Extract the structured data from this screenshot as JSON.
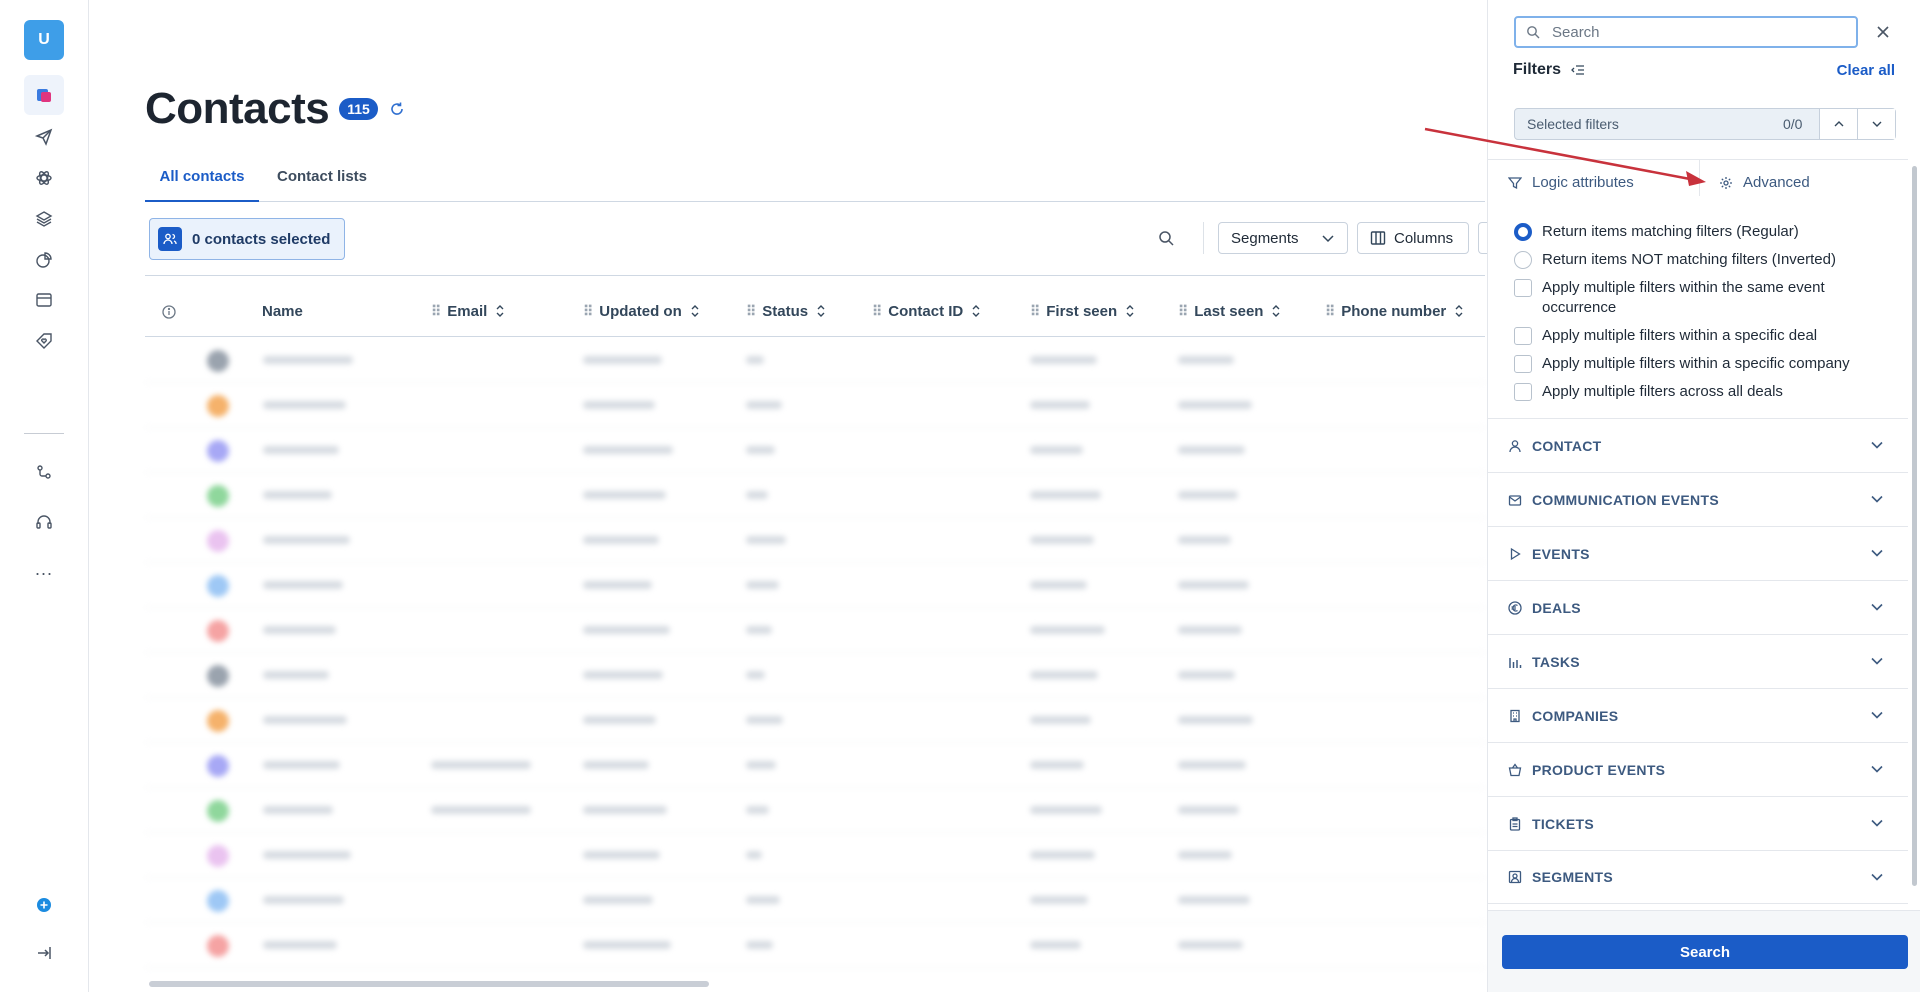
{
  "rail": {
    "avatar_initial": "U",
    "icons": [
      "contacts-icon",
      "send-icon",
      "atom-icon",
      "layers-icon",
      "pie-chart-icon",
      "browser-icon",
      "tag-heart-icon",
      "flow-icon",
      "headset-icon"
    ],
    "more_label": "...",
    "bottom_icons": [
      "add-circle-icon",
      "logout-icon"
    ]
  },
  "header": {
    "title": "Contacts",
    "count": "115"
  },
  "tabs": [
    {
      "label": "All contacts",
      "active": true
    },
    {
      "label": "Contact lists",
      "active": false
    }
  ],
  "toolbar": {
    "selected_label": "0 contacts selected",
    "segments_label": "Segments",
    "columns_label": "Columns"
  },
  "table": {
    "columns": [
      "Name",
      "Email",
      "Updated on",
      "Status",
      "Contact ID",
      "First seen",
      "Last seen",
      "Phone number"
    ]
  },
  "panel": {
    "search_placeholder": "Search",
    "filters_title": "Filters",
    "clear_all": "Clear all",
    "selected_filters_label": "Selected filters",
    "selected_filters_count": "0/0",
    "subtab_logic": "Logic attributes",
    "subtab_advanced": "Advanced",
    "options": [
      {
        "type": "radio",
        "checked": true,
        "label": "Return items matching filters (Regular)"
      },
      {
        "type": "radio",
        "checked": false,
        "label": "Return items NOT matching filters (Inverted)"
      },
      {
        "type": "checkbox",
        "checked": false,
        "label": "Apply multiple filters within the same event occurrence"
      },
      {
        "type": "checkbox",
        "checked": false,
        "label": "Apply multiple filters within a specific deal"
      },
      {
        "type": "checkbox",
        "checked": false,
        "label": "Apply multiple filters within a specific company"
      },
      {
        "type": "checkbox",
        "checked": false,
        "label": "Apply multiple filters across all deals"
      }
    ],
    "sections": [
      {
        "label": "CONTACT",
        "icon": "person-icon"
      },
      {
        "label": "COMMUNICATION EVENTS",
        "icon": "mail-open-icon"
      },
      {
        "label": "EVENTS",
        "icon": "play-icon"
      },
      {
        "label": "DEALS",
        "icon": "euro-icon"
      },
      {
        "label": "TASKS",
        "icon": "bar-chart-icon"
      },
      {
        "label": "COMPANIES",
        "icon": "building-icon"
      },
      {
        "label": "PRODUCT EVENTS",
        "icon": "basket-icon"
      },
      {
        "label": "TICKETS",
        "icon": "clipboard-icon"
      },
      {
        "label": "SEGMENTS",
        "icon": "segment-icon"
      }
    ],
    "search_button": "Search"
  },
  "colors": {
    "accent": "#1b5cc7",
    "annotation_arrow": "#c8323c"
  }
}
